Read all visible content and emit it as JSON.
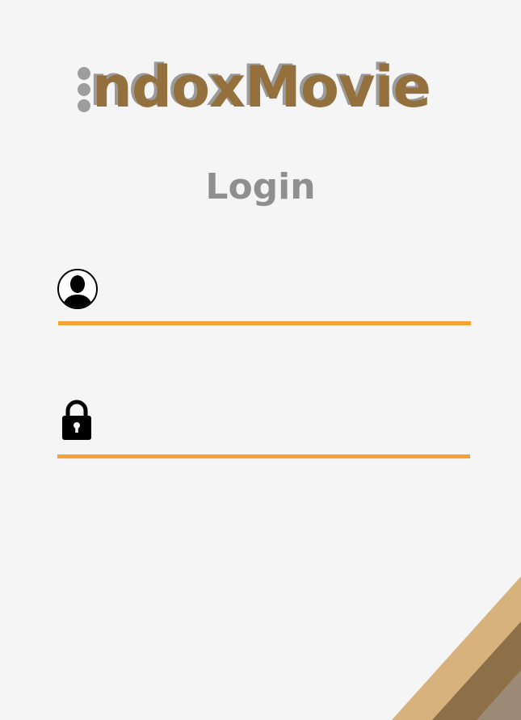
{
  "app": {
    "logo_text": "ndoxMovie"
  },
  "login": {
    "title": "Login",
    "username": {
      "icon": "user-icon",
      "value": "",
      "placeholder": ""
    },
    "password": {
      "icon": "lock-icon",
      "value": "",
      "placeholder": ""
    }
  },
  "colors": {
    "accent": "#f4a235",
    "brand_brown": "#93703c",
    "logo_gray": "#9b9b9b",
    "title_gray": "#8f8f8f",
    "corner_light": "#d8b27c",
    "corner_dark": "#8d7048",
    "corner_gray": "#9b8a75",
    "background": "#f5f5f5"
  }
}
